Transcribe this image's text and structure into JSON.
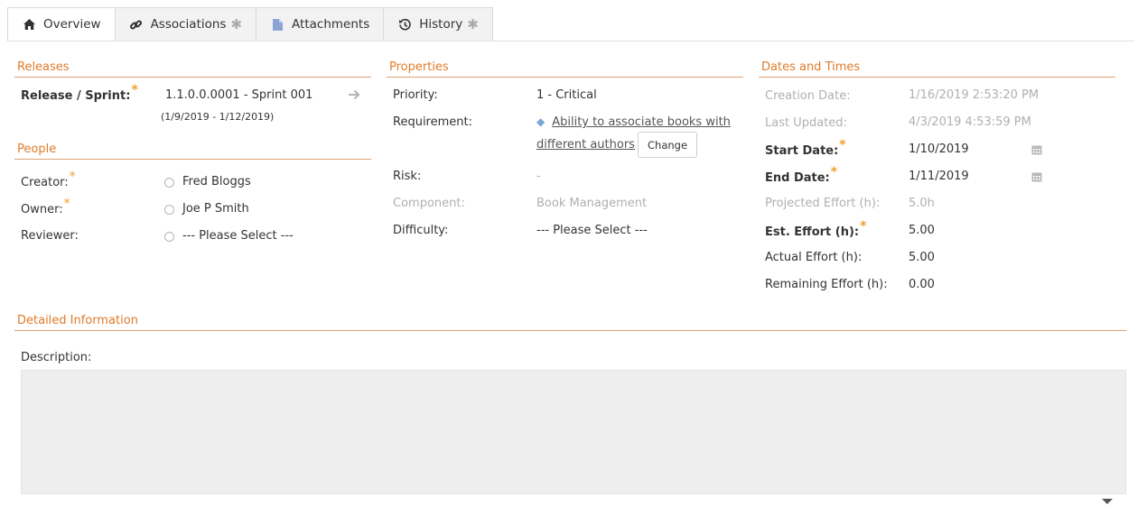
{
  "tabs": [
    {
      "label": "Overview",
      "icon": "home-icon",
      "starred": false
    },
    {
      "label": "Associations",
      "icon": "link-icon",
      "starred": true
    },
    {
      "label": "Attachments",
      "icon": "document-icon",
      "starred": false
    },
    {
      "label": "History",
      "icon": "history-icon",
      "starred": true
    }
  ],
  "releases": {
    "title": "Releases",
    "release_label": "Release / Sprint:",
    "release_value": "1.1.0.0.0001 - Sprint 001",
    "release_dates": "(1/9/2019 - 1/12/2019)"
  },
  "people": {
    "title": "People",
    "creator_label": "Creator:",
    "creator_value": "Fred Bloggs",
    "owner_label": "Owner:",
    "owner_value": "Joe P Smith",
    "reviewer_label": "Reviewer:",
    "reviewer_value": "--- Please Select ---"
  },
  "properties": {
    "title": "Properties",
    "priority_label": "Priority:",
    "priority_value": "1 - Critical",
    "requirement_label": "Requirement:",
    "requirement_value": "Ability to associate books with different authors",
    "change_label": "Change",
    "risk_label": "Risk:",
    "risk_value": "-",
    "component_label": "Component:",
    "component_value": "Book Management",
    "difficulty_label": "Difficulty:",
    "difficulty_value": "--- Please Select ---"
  },
  "dates": {
    "title": "Dates and Times",
    "creation_label": "Creation Date:",
    "creation_value": "1/16/2019 2:53:20 PM",
    "updated_label": "Last Updated:",
    "updated_value": "4/3/2019 4:53:59 PM",
    "start_label": "Start Date:",
    "start_value": "1/10/2019",
    "end_label": "End Date:",
    "end_value": "1/11/2019",
    "projected_label": "Projected Effort (h):",
    "projected_value": "5.0h",
    "est_label": "Est. Effort (h):",
    "est_value": "5.00",
    "actual_label": "Actual Effort (h):",
    "actual_value": "5.00",
    "remaining_label": "Remaining Effort (h):",
    "remaining_value": "0.00"
  },
  "detailed": {
    "title": "Detailed Information",
    "description_label": "Description:"
  },
  "colors": {
    "accent": "#e07b2a",
    "required_star": "#f0a030",
    "muted_text": "#b0b0b0"
  }
}
